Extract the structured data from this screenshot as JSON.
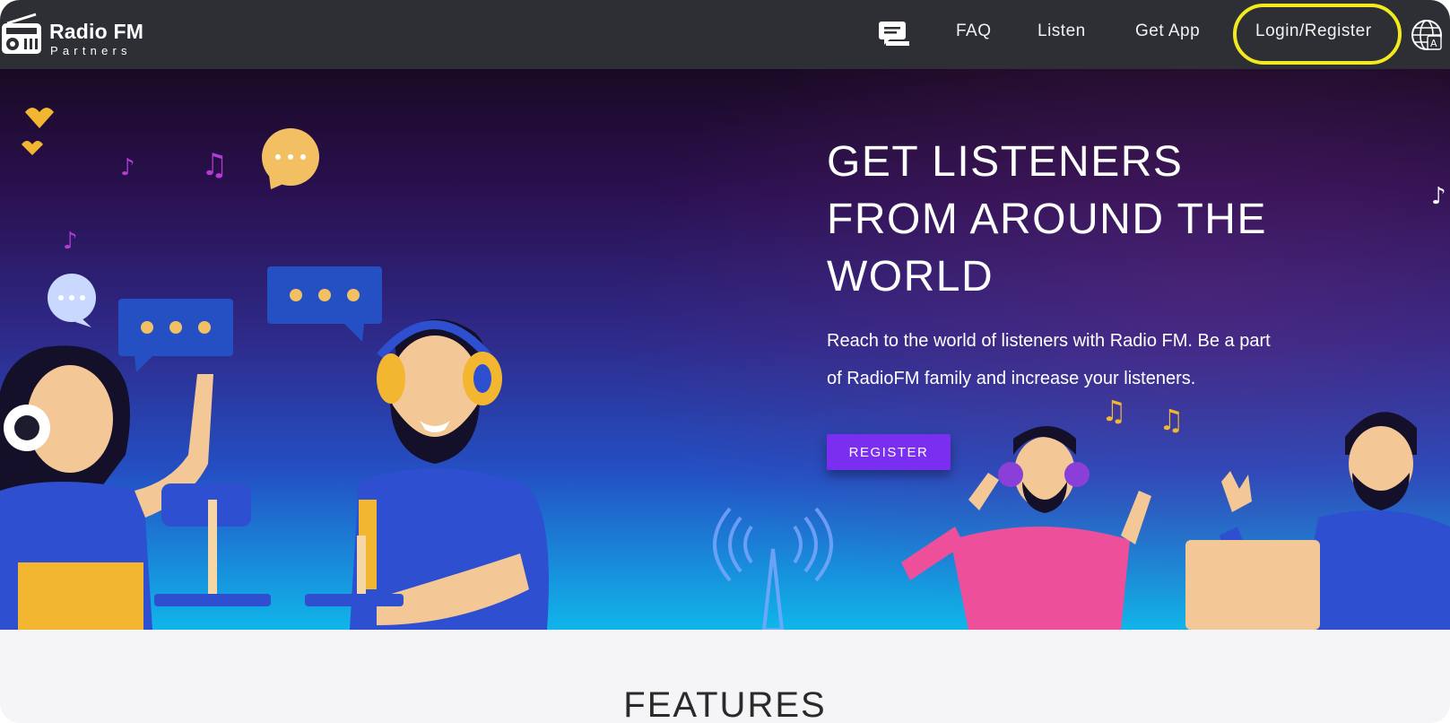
{
  "brand": {
    "name": "Radio FM",
    "subtitle": "Partners",
    "icon": "radio-icon"
  },
  "nav": {
    "chat_icon": "chat-icon",
    "faq": "FAQ",
    "listen": "Listen",
    "get_app": "Get App",
    "login": "Login/Register",
    "language_icon": "globe-language-icon",
    "highlight_color": "#f2ea1f"
  },
  "hero": {
    "title_lines": [
      "GET LISTENERS",
      "FROM AROUND THE",
      "WORLD"
    ],
    "description_lines": [
      "Reach to the world of listeners with Radio FM. Be a part",
      "of RadioFM family and increase your listeners."
    ],
    "register_label": "REGISTER",
    "accent_color": "#7a2ef0"
  },
  "features": {
    "title": "FEATURES"
  }
}
